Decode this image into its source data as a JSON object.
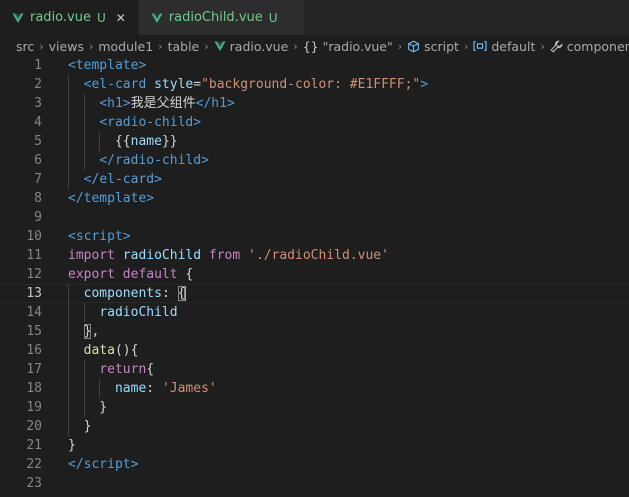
{
  "tabs": [
    {
      "label": "radio.vue",
      "status": "U",
      "close": "✕",
      "icon": "vue-icon",
      "active": true
    },
    {
      "label": "radioChild.vue",
      "status": "U",
      "close": "",
      "icon": "vue-icon",
      "active": false
    }
  ],
  "breadcrumb": {
    "items": [
      {
        "label": "src"
      },
      {
        "label": "views"
      },
      {
        "label": "module1"
      },
      {
        "label": "table"
      },
      {
        "label": "radio.vue",
        "icon": "vue-icon"
      },
      {
        "label": "\"radio.vue\"",
        "icon": "braces-icon",
        "icon_text": "{}"
      },
      {
        "label": "script",
        "icon": "cube-icon"
      },
      {
        "label": "default",
        "icon": "field-icon"
      },
      {
        "label": "components",
        "icon": "wrench-icon"
      }
    ],
    "separator": "›"
  },
  "editor": {
    "current_line": 13,
    "lines": [
      {
        "n": "1",
        "tokens": [
          [
            "tag",
            "<"
          ],
          [
            "tag",
            "template"
          ],
          [
            "tag",
            ">"
          ]
        ]
      },
      {
        "n": "2",
        "tokens": [
          [
            "text",
            "  "
          ],
          [
            "tag",
            "<"
          ],
          [
            "tag",
            "el-card"
          ],
          [
            "text",
            " "
          ],
          [
            "attr",
            "style"
          ],
          [
            "text",
            "="
          ],
          [
            "str",
            "\"background-color: #E1FFFF;\""
          ],
          [
            "tag",
            ">"
          ]
        ]
      },
      {
        "n": "3",
        "tokens": [
          [
            "text",
            "    "
          ],
          [
            "tag",
            "<"
          ],
          [
            "tag",
            "h1"
          ],
          [
            "tag",
            ">"
          ],
          [
            "text",
            "我是父组件"
          ],
          [
            "tag",
            "</"
          ],
          [
            "tag",
            "h1"
          ],
          [
            "tag",
            ">"
          ]
        ]
      },
      {
        "n": "4",
        "tokens": [
          [
            "text",
            "    "
          ],
          [
            "tag",
            "<"
          ],
          [
            "tag",
            "radio-child"
          ],
          [
            "tag",
            ">"
          ]
        ]
      },
      {
        "n": "5",
        "tokens": [
          [
            "text",
            "      "
          ],
          [
            "text",
            "{{"
          ],
          [
            "var",
            "name"
          ],
          [
            "text",
            "}}"
          ]
        ]
      },
      {
        "n": "6",
        "tokens": [
          [
            "text",
            "    "
          ],
          [
            "tag",
            "</"
          ],
          [
            "tag",
            "radio-child"
          ],
          [
            "tag",
            ">"
          ]
        ]
      },
      {
        "n": "7",
        "tokens": [
          [
            "text",
            "  "
          ],
          [
            "tag",
            "</"
          ],
          [
            "tag",
            "el-card"
          ],
          [
            "tag",
            ">"
          ]
        ]
      },
      {
        "n": "8",
        "tokens": [
          [
            "tag",
            "</"
          ],
          [
            "tag",
            "template"
          ],
          [
            "tag",
            ">"
          ]
        ]
      },
      {
        "n": "9",
        "tokens": []
      },
      {
        "n": "10",
        "tokens": [
          [
            "tag",
            "<"
          ],
          [
            "tag",
            "script"
          ],
          [
            "tag",
            ">"
          ]
        ]
      },
      {
        "n": "11",
        "tokens": [
          [
            "kw",
            "import"
          ],
          [
            "text",
            " "
          ],
          [
            "var",
            "radioChild"
          ],
          [
            "text",
            " "
          ],
          [
            "kw",
            "from"
          ],
          [
            "text",
            " "
          ],
          [
            "str",
            "'./radioChild.vue'"
          ]
        ]
      },
      {
        "n": "12",
        "tokens": [
          [
            "kw",
            "export"
          ],
          [
            "text",
            " "
          ],
          [
            "kw",
            "default"
          ],
          [
            "text",
            " {"
          ]
        ]
      },
      {
        "n": "13",
        "tokens": [
          [
            "text",
            "  "
          ],
          [
            "var",
            "components"
          ],
          [
            "text",
            ": "
          ],
          [
            "hl",
            "{"
          ]
        ]
      },
      {
        "n": "14",
        "tokens": [
          [
            "text",
            "    "
          ],
          [
            "var",
            "radioChild"
          ]
        ]
      },
      {
        "n": "15",
        "tokens": [
          [
            "text",
            "  "
          ],
          [
            "hl",
            "}"
          ],
          [
            "text",
            ","
          ]
        ]
      },
      {
        "n": "16",
        "tokens": [
          [
            "text",
            "  "
          ],
          [
            "fn",
            "data"
          ],
          [
            "text",
            "(){"
          ]
        ]
      },
      {
        "n": "17",
        "tokens": [
          [
            "text",
            "    "
          ],
          [
            "kw",
            "return"
          ],
          [
            "text",
            "{"
          ]
        ]
      },
      {
        "n": "18",
        "tokens": [
          [
            "text",
            "      "
          ],
          [
            "var",
            "name"
          ],
          [
            "text",
            ": "
          ],
          [
            "str",
            "'James'"
          ]
        ]
      },
      {
        "n": "19",
        "tokens": [
          [
            "text",
            "    }"
          ]
        ]
      },
      {
        "n": "20",
        "tokens": [
          [
            "text",
            "  }"
          ]
        ]
      },
      {
        "n": "21",
        "tokens": [
          [
            "text",
            "}"
          ]
        ]
      },
      {
        "n": "22",
        "tokens": [
          [
            "tag",
            "</"
          ],
          [
            "tag",
            "script"
          ],
          [
            "tag",
            ">"
          ]
        ]
      },
      {
        "n": "23",
        "tokens": []
      }
    ]
  },
  "colors": {
    "background": "#1e1e1e",
    "tab_bar": "#252526",
    "untracked": "#73c991",
    "vue_green": "#41b883",
    "tag": "#569cd6",
    "string": "#ce9178",
    "attribute": "#9cdcfe",
    "keyword": "#c586c0",
    "function": "#dcdcaa"
  }
}
